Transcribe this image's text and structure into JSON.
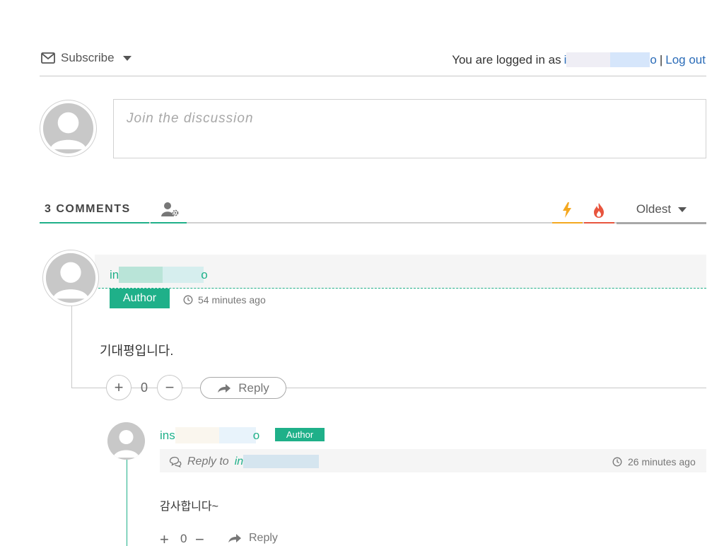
{
  "header": {
    "subscribe_label": "Subscribe",
    "login_prefix": "You are logged in as",
    "login_user_visible_start": "i",
    "login_user_visible_end": "o",
    "separator": "|",
    "logout_label": "Log out"
  },
  "composer": {
    "placeholder": "Join the discussion"
  },
  "tabs": {
    "comment_count_label": "3 COMMENTS",
    "sort_selected": "Oldest"
  },
  "comments": [
    {
      "author_visible_start": "in",
      "author_visible_end": "o",
      "badge": "Author",
      "time": "54 minutes ago",
      "text": "기대평입니다.",
      "votes": "0",
      "reply_label": "Reply"
    },
    {
      "author_visible_start": "ins",
      "author_visible_end": "o",
      "badge": "Author",
      "reply_to_prefix": "Reply to",
      "reply_to_visible_start": "in",
      "time": "26 minutes ago",
      "text": "감사합니다~",
      "votes": "0",
      "reply_label": "Reply"
    }
  ],
  "colors": {
    "accent": "#1fb089",
    "bolt": "#f4a820",
    "fire": "#e8553e",
    "link": "#2b6cb8"
  },
  "icons": {
    "subscribe": "envelope-icon",
    "user_settings": "user-gear-icon",
    "newest": "bolt-icon",
    "hot": "fire-icon",
    "time": "clock-icon",
    "reply": "reply-arrow-icon",
    "reply_to": "chat-bubbles-icon"
  }
}
